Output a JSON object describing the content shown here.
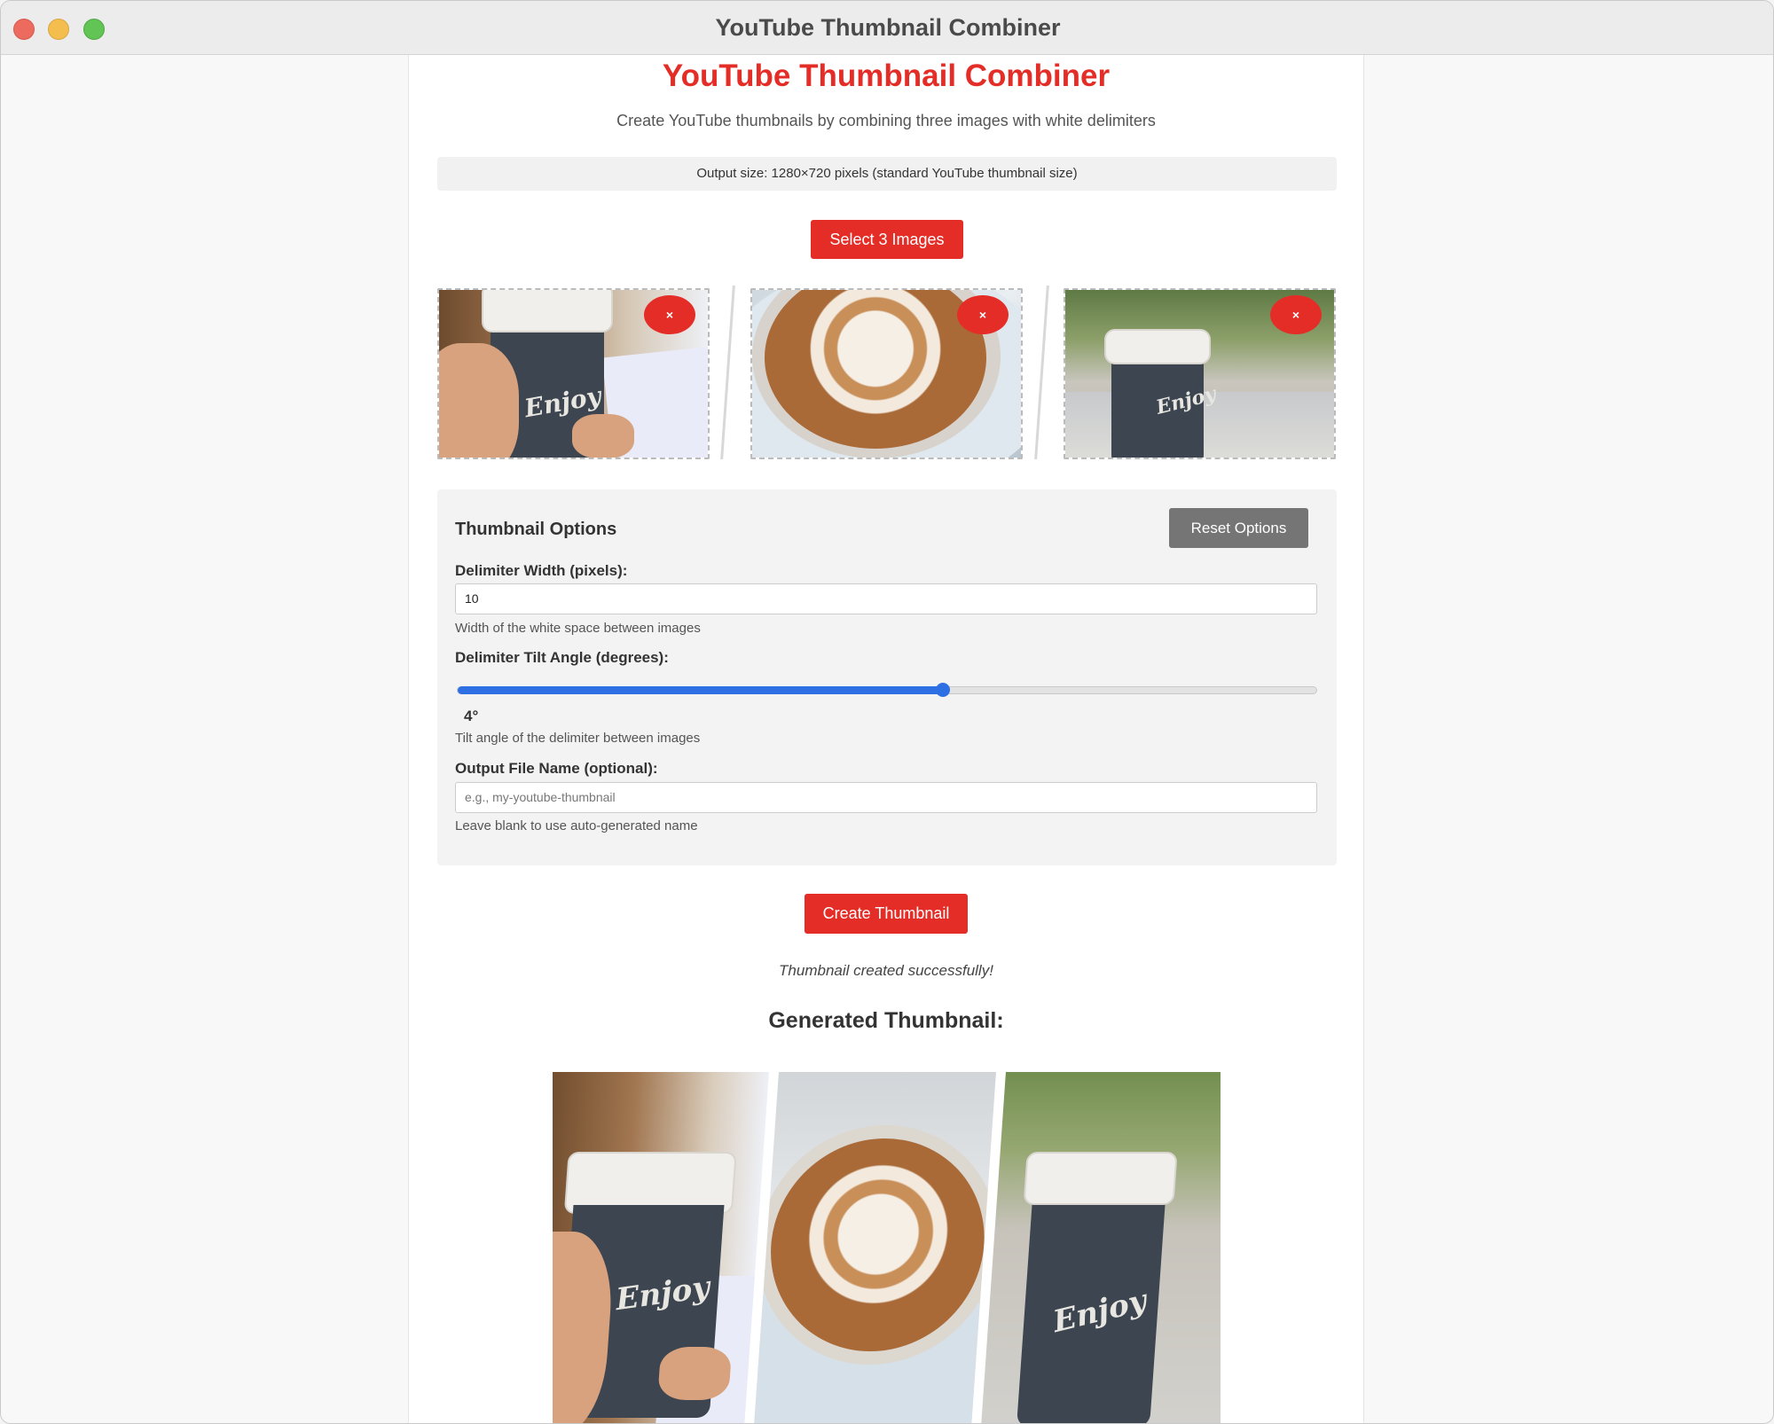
{
  "window": {
    "title": "YouTube Thumbnail Combiner"
  },
  "header": {
    "title": "YouTube Thumbnail Combiner",
    "subtitle": "Create YouTube thumbnails by combining three images with white delimiters",
    "output_size": "Output size: 1280×720 pixels (standard YouTube thumbnail size)"
  },
  "select_button": "Select 3 Images",
  "previews": [
    {
      "remove_label": "×",
      "icon": "close-icon"
    },
    {
      "remove_label": "×",
      "icon": "close-icon"
    },
    {
      "remove_label": "×",
      "icon": "close-icon"
    }
  ],
  "options": {
    "title": "Thumbnail Options",
    "reset_label": "Reset Options",
    "delimiter_width": {
      "label": "Delimiter Width (pixels):",
      "value": "10",
      "help": "Width of the white space between images"
    },
    "tilt_angle": {
      "label": "Delimiter Tilt Angle (degrees):",
      "value_text": "4°",
      "level": 0.565,
      "help": "Tilt angle of the delimiter between images"
    },
    "file_name": {
      "label": "Output File Name (optional):",
      "value": "",
      "placeholder": "e.g., my-youtube-thumbnail",
      "help": "Leave blank to use auto-generated name"
    }
  },
  "create_button": "Create Thumbnail",
  "status": "Thumbnail created successfully!",
  "result": {
    "title": "Generated Thumbnail:"
  },
  "colors": {
    "accent": "#e52d27",
    "slider": "#2f6fe4",
    "reset": "#757575"
  }
}
